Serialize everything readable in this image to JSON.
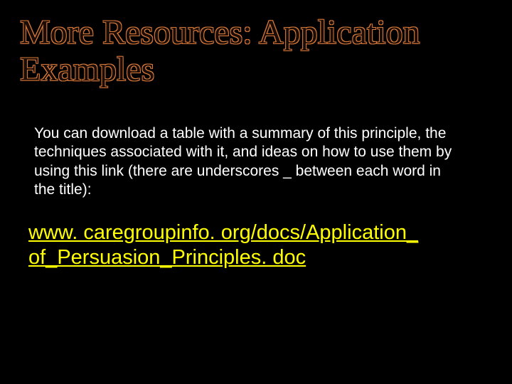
{
  "title": "More Resources:  Application Examples",
  "body_text": "You can download a table with a summary of this principle, the techniques associated with it, and ideas on how to use them by using this link (there are underscores _ between each word in the title):",
  "link_text": "www. caregroupinfo. org/docs/Application_ of_Persuasion_Principles. doc"
}
